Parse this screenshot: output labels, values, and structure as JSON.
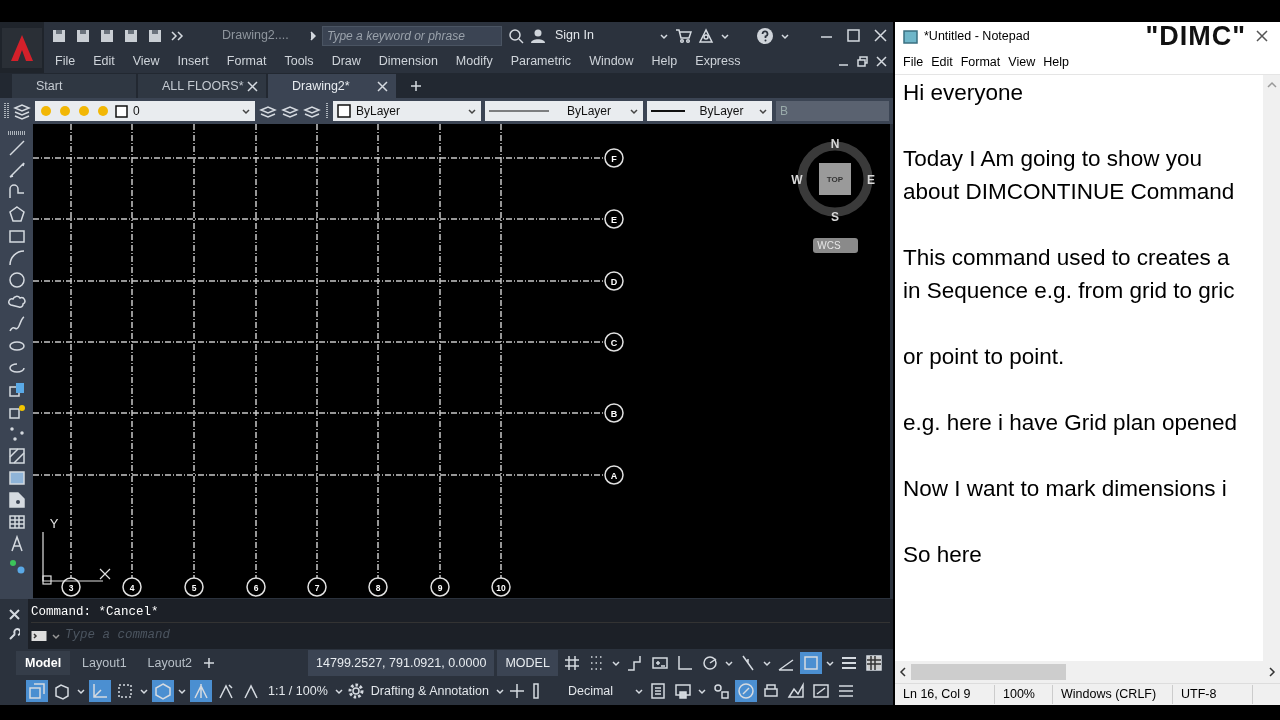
{
  "autocad": {
    "quick_access": {
      "title": "Drawing2....",
      "search": {
        "placeholder": "Type a keyword or phrase"
      },
      "sign_in": "Sign In"
    },
    "menu": [
      "File",
      "Edit",
      "View",
      "Insert",
      "Format",
      "Tools",
      "Draw",
      "Dimension",
      "Modify",
      "Parametric",
      "Window",
      "Help",
      "Express"
    ],
    "tabs": [
      {
        "label": "Start",
        "selected": false,
        "closable": false
      },
      {
        "label": "ALL FLOORS*",
        "selected": false,
        "closable": true
      },
      {
        "label": "Drawing2*",
        "selected": true,
        "closable": true
      }
    ],
    "layer_toolbar": {
      "layer": "0",
      "color_control": "ByLayer",
      "linetype": "ByLayer",
      "lineweight": "ByLayer",
      "cut_field": "B"
    },
    "grid": {
      "row_bubbles": [
        "F",
        "E",
        "D",
        "C",
        "B",
        "A"
      ],
      "column_bubbles": [
        "3",
        "4",
        "5",
        "6",
        "7",
        "8",
        "9",
        "10"
      ]
    },
    "viewcube": {
      "north": "N",
      "south": "S",
      "east": "E",
      "west": "W",
      "face": "TOP",
      "ucs": "WCS"
    },
    "ucs_icon": {
      "axis": "Y"
    },
    "command_line": {
      "history": "Command: *Cancel*",
      "placeholder": "Type a command"
    },
    "layout_tabs": [
      {
        "label": "Model",
        "selected": true
      },
      {
        "label": "Layout1",
        "selected": false
      },
      {
        "label": "Layout2",
        "selected": false
      }
    ],
    "status_bar": {
      "coordinates": "14799.2527, 791.0921, 0.0000",
      "space": "MODEL",
      "scale": "1:1 / 100%",
      "workspace": "Drafting & Annotation",
      "units": "Decimal",
      "row1_toggles": [
        {
          "on": false
        },
        {
          "on": false
        },
        {
          "on": false
        },
        {
          "on": false
        },
        {
          "on": false
        },
        {
          "on": false
        },
        {
          "on": false
        },
        {
          "on": false
        },
        {
          "on": true
        },
        {
          "on": false
        },
        {
          "on": false
        }
      ],
      "row2_toggles": [
        {
          "on": true
        },
        {
          "on": false
        },
        {
          "on": true
        },
        {
          "on": false
        },
        {
          "on": true
        },
        {
          "on": true
        },
        {
          "on": false
        },
        {
          "on": false
        }
      ],
      "row2_right_toggles": [
        {
          "on": false
        },
        {
          "on": false
        },
        {
          "on": false
        },
        {
          "on": true
        },
        {
          "on": false
        },
        {
          "on": false
        },
        {
          "on": false
        },
        {
          "on": false
        }
      ]
    }
  },
  "notepad": {
    "title": "*Untitled - Notepad",
    "caption": "\"DIMC\"",
    "menu": [
      "File",
      "Edit",
      "Format",
      "View",
      "Help"
    ],
    "paragraphs": [
      [
        "Hi everyone"
      ],
      [
        "Today I Am going to show you",
        "about DIMCONTINUE Command"
      ],
      [
        "This command used to creates a",
        "in Sequence e.g. from grid to gric"
      ],
      [
        "or point to point."
      ],
      [
        "e.g. here i have Grid plan opened"
      ],
      [
        "Now I want to mark dimensions i"
      ],
      [
        "So here"
      ]
    ],
    "status": [
      "Ln 16, Col 9",
      "100%",
      "Windows (CRLF)",
      "UTF-8"
    ]
  }
}
